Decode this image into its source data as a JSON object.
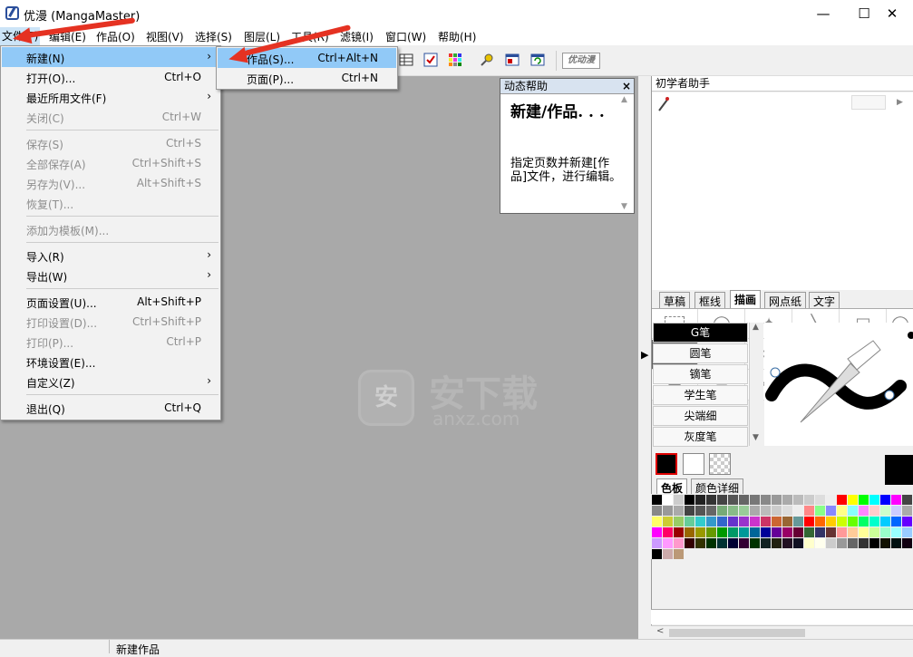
{
  "window": {
    "title": "优漫 (MangaMaster)",
    "minimize_icon": "minimize-icon",
    "maximize_icon": "maximize-icon",
    "close_icon": "close-icon"
  },
  "menubar": [
    {
      "label": "文件(F)"
    },
    {
      "label": "编辑(E)"
    },
    {
      "label": "作品(O)"
    },
    {
      "label": "视图(V)"
    },
    {
      "label": "选择(S)"
    },
    {
      "label": "图层(L)"
    },
    {
      "label": "工具(R)"
    },
    {
      "label": "滤镜(I)"
    },
    {
      "label": "窗口(W)"
    },
    {
      "label": "帮助(H)"
    }
  ],
  "file_menu": [
    {
      "label": "新建(N)",
      "shortcut": "",
      "submenu": true,
      "disabled": false
    },
    {
      "label": "打开(O)...",
      "shortcut": "Ctrl+O",
      "submenu": false,
      "disabled": false
    },
    {
      "label": "最近所用文件(F)",
      "shortcut": "",
      "submenu": true,
      "disabled": false
    },
    {
      "label": "关闭(C)",
      "shortcut": "Ctrl+W",
      "submenu": false,
      "disabled": true
    },
    {
      "label": "保存(S)",
      "shortcut": "Ctrl+S",
      "submenu": false,
      "disabled": true
    },
    {
      "label": "全部保存(A)",
      "shortcut": "Ctrl+Shift+S",
      "submenu": false,
      "disabled": true
    },
    {
      "label": "另存为(V)...",
      "shortcut": "Alt+Shift+S",
      "submenu": false,
      "disabled": true
    },
    {
      "label": "恢复(T)...",
      "shortcut": "",
      "submenu": false,
      "disabled": true
    },
    {
      "label": "添加为模板(M)...",
      "shortcut": "",
      "submenu": false,
      "disabled": true
    },
    {
      "label": "导入(R)",
      "shortcut": "",
      "submenu": true,
      "disabled": false
    },
    {
      "label": "导出(W)",
      "shortcut": "",
      "submenu": true,
      "disabled": false
    },
    {
      "label": "页面设置(U)...",
      "shortcut": "Alt+Shift+P",
      "submenu": false,
      "disabled": false
    },
    {
      "label": "打印设置(D)...",
      "shortcut": "Ctrl+Shift+P",
      "submenu": false,
      "disabled": true
    },
    {
      "label": "打印(P)...",
      "shortcut": "Ctrl+P",
      "submenu": false,
      "disabled": true
    },
    {
      "label": "环境设置(E)...",
      "shortcut": "",
      "submenu": false,
      "disabled": false
    },
    {
      "label": "自定义(Z)",
      "shortcut": "",
      "submenu": true,
      "disabled": false
    },
    {
      "label": "退出(Q)",
      "shortcut": "Ctrl+Q",
      "submenu": false,
      "disabled": false
    }
  ],
  "new_submenu": [
    {
      "label": "作品(S)...",
      "shortcut": "Ctrl+Alt+N"
    },
    {
      "label": "页面(P)...",
      "shortcut": "Ctrl+N"
    }
  ],
  "toolbar": {
    "logo_text": "优动漫"
  },
  "help_panel": {
    "header": "动态帮助",
    "close": "×",
    "title": "新建/作品. . .",
    "body": "指定页数并新建[作品]文件，进行编辑。"
  },
  "assistant": {
    "header": "初学者助手"
  },
  "tool_tabs": [
    "草稿",
    "框线",
    "描画",
    "网点纸",
    "文字"
  ],
  "pen_list": [
    "G笔",
    "圆笔",
    "镝笔",
    "学生笔",
    "尖端细",
    "灰度笔"
  ],
  "color_tabs": [
    "色板",
    "颜色详细"
  ],
  "status": {
    "text": "新建作品"
  },
  "watermark": {
    "text": "安下载",
    "sub": "anxz.com",
    "badge": "安"
  },
  "colors": {
    "accent": "#91c9f7",
    "canvas": "#a9a9a9",
    "annotation": "#e53222"
  }
}
